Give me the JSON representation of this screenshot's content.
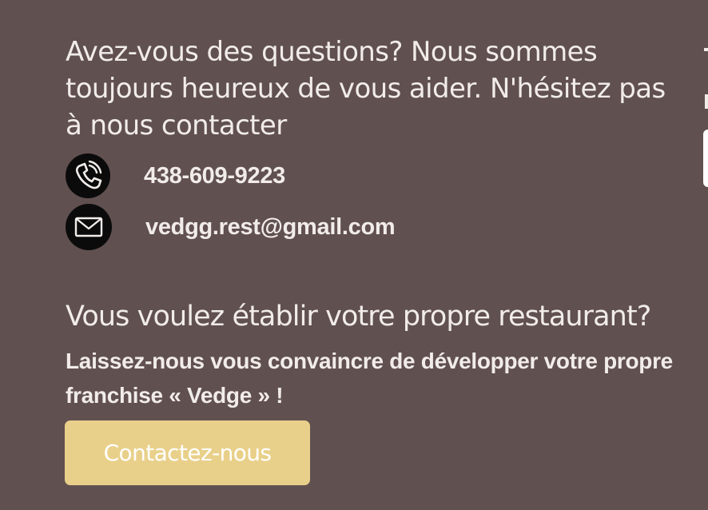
{
  "contact": {
    "intro": "Avez-vous des questions? Nous sommes toujours heureux de vous aider. N'hésitez pas à nous contacter",
    "phone": "438-609-9223",
    "email": "vedgg.rest@gmail.com",
    "icons": {
      "phone": "phone-icon",
      "email": "envelope-icon"
    }
  },
  "franchise": {
    "title": "Vous voulez établir votre propre restaurant?",
    "subtitle": "Laissez-nous vous convaincre de développer votre propre franchise « Vedge » !",
    "button_label": "Contactez-nous"
  },
  "colors": {
    "background": "#615050",
    "text": "#f1ecea",
    "button": "#e9d08a",
    "icon_circle": "#0b0b0b"
  }
}
